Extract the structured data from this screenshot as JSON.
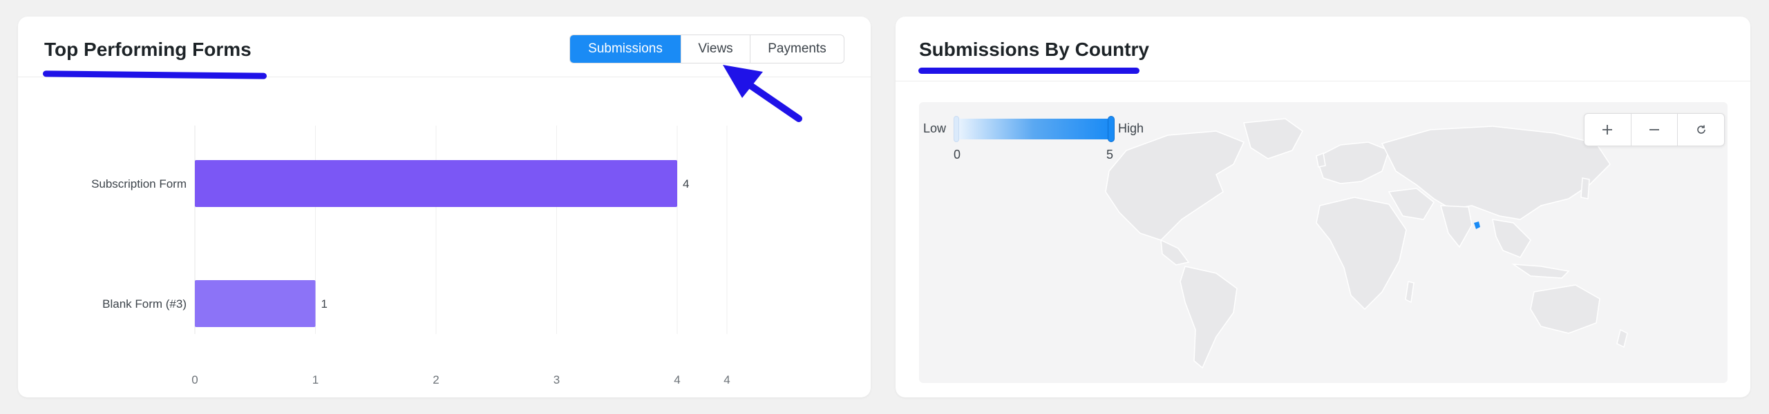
{
  "top_forms": {
    "title": "Top Performing Forms",
    "tabs": [
      {
        "label": "Submissions",
        "active": true
      },
      {
        "label": "Views",
        "active": false
      },
      {
        "label": "Payments",
        "active": false
      }
    ],
    "accent_color": "#1a8bf5",
    "annotation_color": "#1f12e8"
  },
  "chart_data": {
    "type": "bar",
    "orientation": "horizontal",
    "categories": [
      "Subscription Form",
      "Blank Form (#3)"
    ],
    "values": [
      4,
      1
    ],
    "data_labels": [
      "4",
      "1"
    ],
    "x_ticks": [
      "0",
      "1",
      "2",
      "3",
      "4",
      "4"
    ],
    "xlim": [
      0,
      4
    ],
    "bar_colors": [
      "#7b57f5",
      "#8c73f7"
    ],
    "grid": true,
    "title": "",
    "xlabel": "",
    "ylabel": ""
  },
  "country": {
    "title": "Submissions By Country",
    "legend": {
      "low": "Low",
      "high": "High",
      "min": "0",
      "max": "5"
    },
    "zoom": {
      "in_icon": "plus-icon",
      "out_icon": "minus-icon",
      "reset_icon": "refresh-icon"
    },
    "highlight_color": "#1a8bf5",
    "land_color": "#e8e8ea"
  }
}
